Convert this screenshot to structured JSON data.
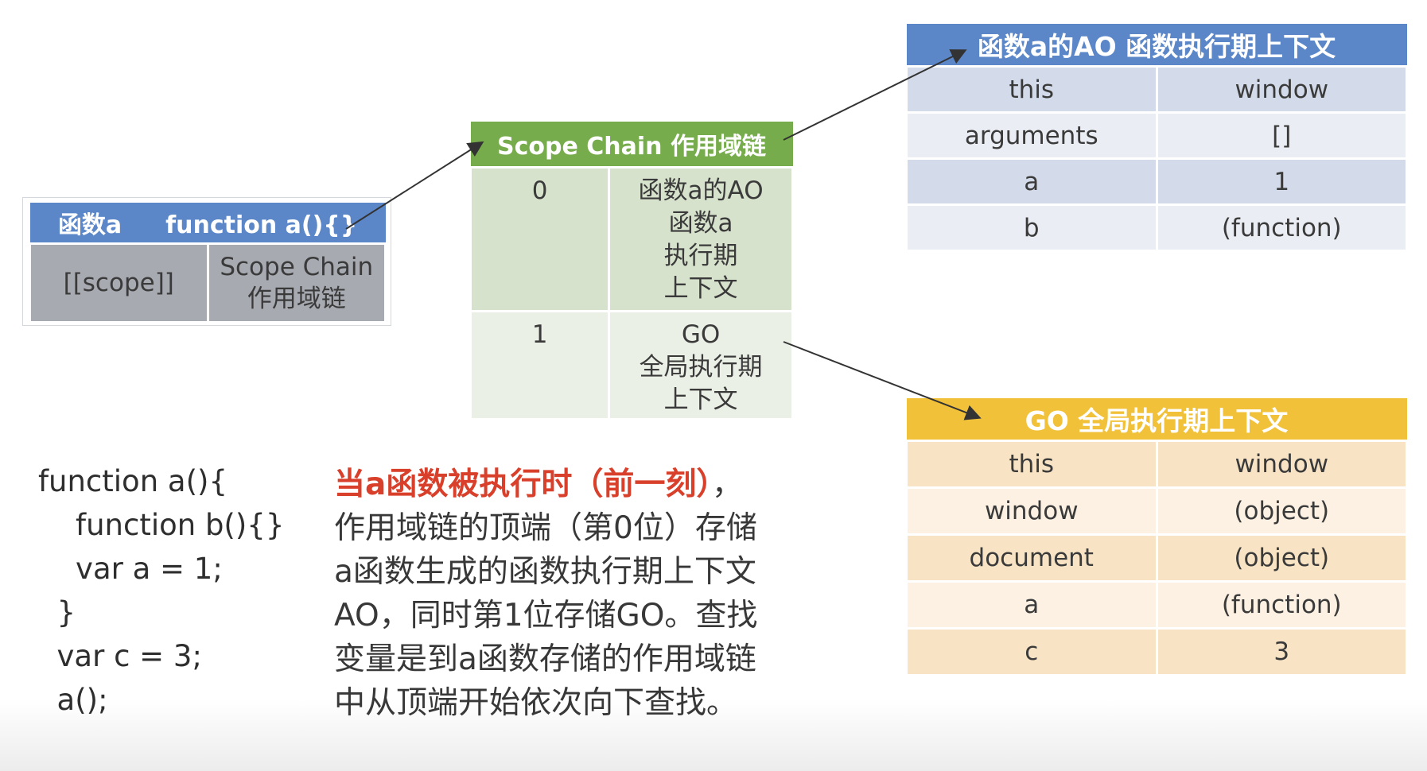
{
  "function_box": {
    "header_name": "函数a",
    "header_code": "function a(){}",
    "key": "[[scope]]",
    "value_line1": "Scope Chain",
    "value_line2": "作用域链"
  },
  "scope_chain": {
    "title": "Scope Chain 作用域链",
    "rows": [
      {
        "index": "0",
        "lines": [
          "函数a的AO",
          "函数a",
          "执行期",
          "上下文"
        ]
      },
      {
        "index": "1",
        "lines": [
          "GO",
          "全局执行期",
          "上下文"
        ]
      }
    ]
  },
  "ao_table": {
    "title": "函数a的AO 函数执行期上下文",
    "rows": [
      {
        "key": "this",
        "value": "window"
      },
      {
        "key": "arguments",
        "value": "[]"
      },
      {
        "key": "a",
        "value": "1"
      },
      {
        "key": "b",
        "value": "(function)"
      }
    ]
  },
  "go_table": {
    "title": "GO 全局执行期上下文",
    "rows": [
      {
        "key": "this",
        "value": "window"
      },
      {
        "key": "window",
        "value": "(object)"
      },
      {
        "key": "document",
        "value": "(object)"
      },
      {
        "key": "a",
        "value": "(function)"
      },
      {
        "key": "c",
        "value": "3"
      }
    ]
  },
  "code_lines": [
    "function a(){",
    "    function b(){}",
    "    var a = 1;",
    "  }",
    "  var c = 3;",
    "  a();"
  ],
  "note": {
    "highlight": "当a函数被执行时（前一刻）",
    "highlight_suffix": "，",
    "lines": [
      "作用域链的顶端（第0位）存储",
      "a函数生成的函数执行期上下文",
      "AO，同时第1位存储GO。查找",
      "变量是到a函数存储的作用域链",
      "中从顶端开始依次向下查找。"
    ]
  },
  "colors": {
    "blue_header": "#5b87c9",
    "green_header": "#77ac4c",
    "yellow_header": "#f2c13a",
    "highlight_red": "#d9402b"
  }
}
